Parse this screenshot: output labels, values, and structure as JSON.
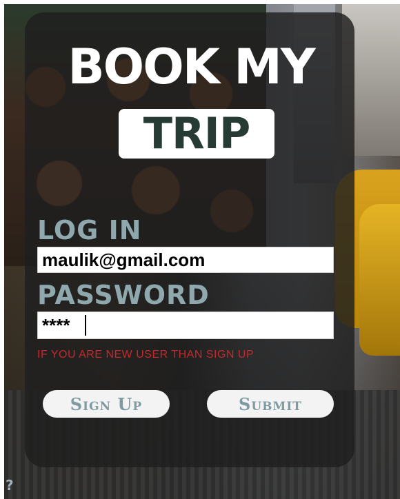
{
  "logo": {
    "line1": "BOOK MY",
    "line2": "TRIP"
  },
  "login_form": {
    "email_label": "LOG IN",
    "email_value": "maulik@gmail.com",
    "password_label": "PASSWORD",
    "password_value": "****",
    "signup_notice": "IF YOU ARE NEW USER THAN SIGN UP",
    "signup_button": "Sign Up",
    "submit_button": "Submit"
  },
  "help": {
    "label": "?"
  },
  "colors": {
    "label": "#8fa8ad",
    "notice": "#c8282c",
    "button_text": "#7f9aa0",
    "card_bg": "rgba(30,30,30,0.82)"
  }
}
